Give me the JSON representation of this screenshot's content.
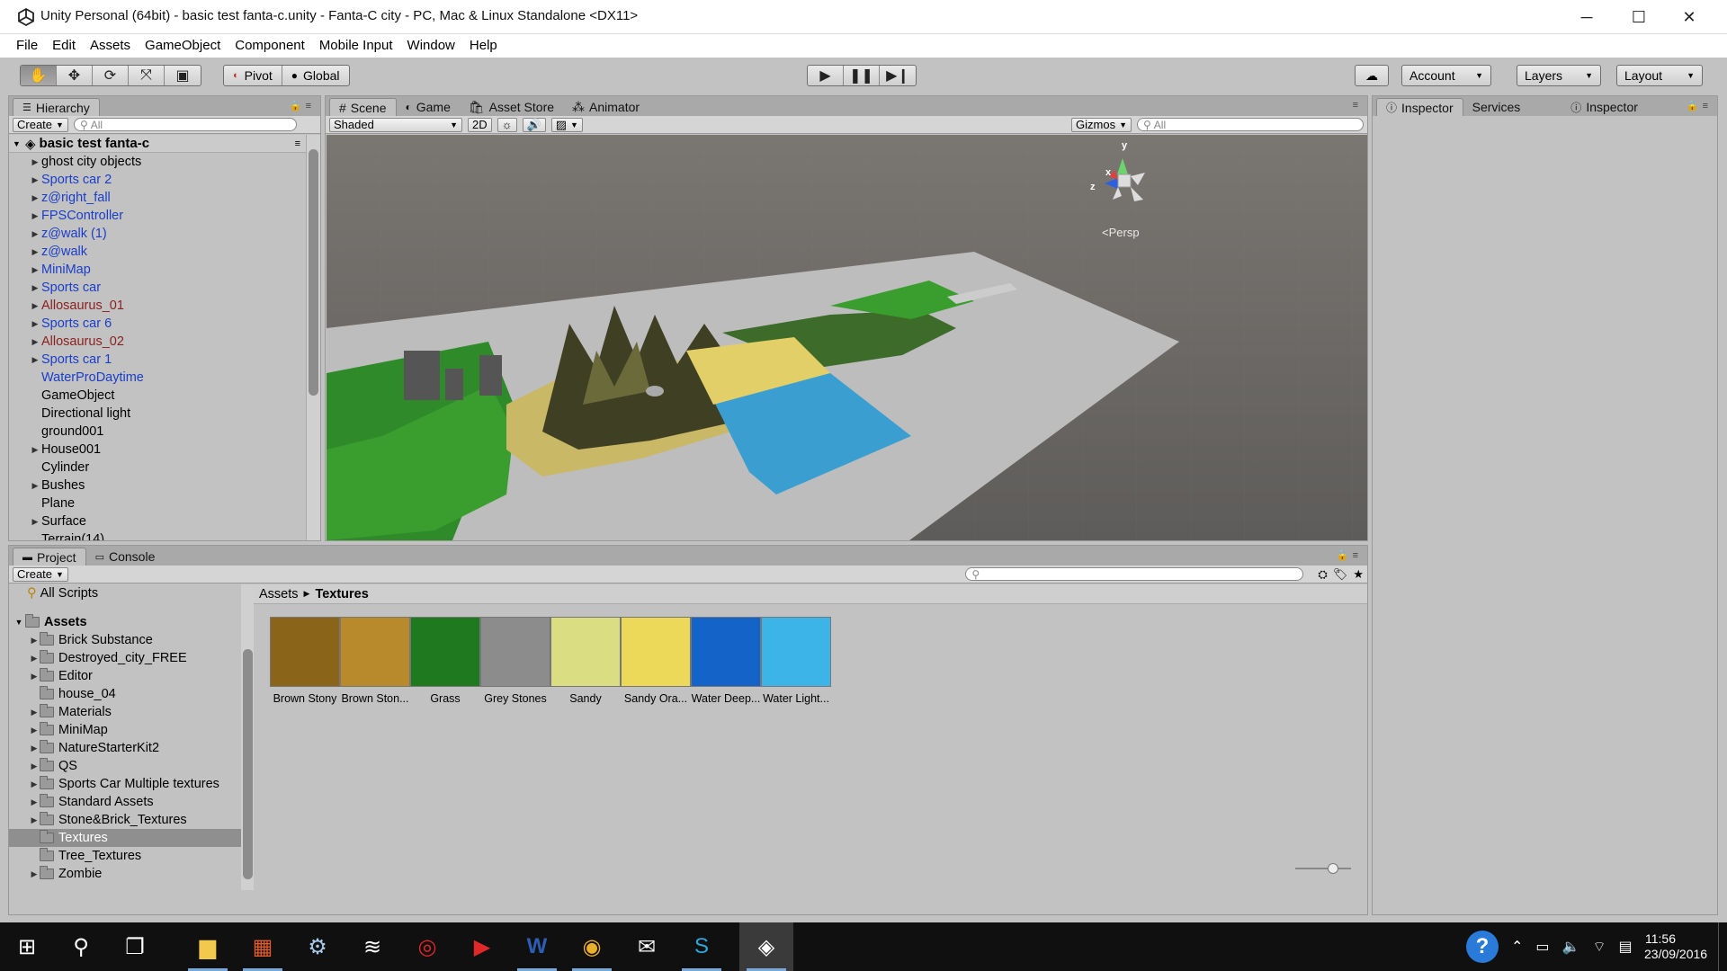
{
  "window": {
    "title": "Unity Personal (64bit) - basic test fanta-c.unity - Fanta-C city - PC, Mac & Linux Standalone <DX11>",
    "minimize": "─",
    "maximize": "☐",
    "close": "✕"
  },
  "menu": [
    "File",
    "Edit",
    "Assets",
    "GameObject",
    "Component",
    "Mobile Input",
    "Window",
    "Help"
  ],
  "toolbar": {
    "pivot": "Pivot",
    "global": "Global",
    "account": "Account",
    "layers": "Layers",
    "layout": "Layout"
  },
  "hierarchy": {
    "tab": "Hierarchy",
    "create": "Create",
    "search_placeholder": "All",
    "scene": "basic test fanta-c",
    "items": [
      {
        "label": "ghost city objects",
        "expand": true,
        "color": "black"
      },
      {
        "label": "Sports car 2",
        "expand": true,
        "color": "blue"
      },
      {
        "label": "z@right_fall",
        "expand": true,
        "color": "blue"
      },
      {
        "label": "FPSController",
        "expand": true,
        "color": "blue"
      },
      {
        "label": "z@walk (1)",
        "expand": true,
        "color": "blue"
      },
      {
        "label": "z@walk",
        "expand": true,
        "color": "blue"
      },
      {
        "label": "MiniMap",
        "expand": true,
        "color": "blue"
      },
      {
        "label": "Sports car",
        "expand": true,
        "color": "blue"
      },
      {
        "label": "Allosaurus_01",
        "expand": true,
        "color": "red"
      },
      {
        "label": "Sports car 6",
        "expand": true,
        "color": "blue"
      },
      {
        "label": "Allosaurus_02",
        "expand": true,
        "color": "red"
      },
      {
        "label": "Sports car 1",
        "expand": true,
        "color": "blue"
      },
      {
        "label": "WaterProDaytime",
        "expand": false,
        "color": "blue"
      },
      {
        "label": "GameObject",
        "expand": false,
        "color": "black"
      },
      {
        "label": "Directional light",
        "expand": false,
        "color": "black"
      },
      {
        "label": "ground001",
        "expand": false,
        "color": "black"
      },
      {
        "label": "House001",
        "expand": true,
        "color": "black"
      },
      {
        "label": "Cylinder",
        "expand": false,
        "color": "black"
      },
      {
        "label": "Bushes",
        "expand": true,
        "color": "black"
      },
      {
        "label": "Plane",
        "expand": false,
        "color": "black"
      },
      {
        "label": "Surface",
        "expand": true,
        "color": "black"
      },
      {
        "label": "Terrain(14)",
        "expand": false,
        "color": "black"
      }
    ]
  },
  "scene_tabs": {
    "scene": "Scene",
    "game": "Game",
    "asset_store": "Asset Store",
    "animator": "Animator"
  },
  "scene_bar": {
    "shaded": "Shaded",
    "two_d": "2D",
    "gizmos": "Gizmos",
    "search_placeholder": "All"
  },
  "gizmo": {
    "x": "x",
    "y": "y",
    "z": "z",
    "persp": "Persp"
  },
  "inspector_tabs": {
    "inspector": "Inspector",
    "services": "Services",
    "inspector2": "Inspector"
  },
  "project": {
    "tab": "Project",
    "console": "Console",
    "create": "Create",
    "favorites": [
      {
        "label": "All Scripts"
      }
    ],
    "root": "Assets",
    "folders": [
      {
        "label": "Brick Substance",
        "expand": true,
        "selected": false
      },
      {
        "label": "Destroyed_city_FREE",
        "expand": true,
        "selected": false
      },
      {
        "label": "Editor",
        "expand": true,
        "selected": false
      },
      {
        "label": "house_04",
        "expand": false,
        "selected": false
      },
      {
        "label": "Materials",
        "expand": true,
        "selected": false
      },
      {
        "label": "MiniMap",
        "expand": true,
        "selected": false
      },
      {
        "label": "NatureStarterKit2",
        "expand": true,
        "selected": false
      },
      {
        "label": "QS",
        "expand": true,
        "selected": false
      },
      {
        "label": "Sports Car Multiple textures",
        "expand": true,
        "selected": false
      },
      {
        "label": "Standard Assets",
        "expand": true,
        "selected": false
      },
      {
        "label": "Stone&Brick_Textures",
        "expand": true,
        "selected": false
      },
      {
        "label": "Textures",
        "expand": false,
        "selected": true
      },
      {
        "label": "Tree_Textures",
        "expand": false,
        "selected": false
      },
      {
        "label": "Zombie",
        "expand": true,
        "selected": false
      }
    ],
    "breadcrumb": [
      "Assets",
      "Textures"
    ],
    "assets": [
      {
        "label": "Brown Stony",
        "color": "#8a6418"
      },
      {
        "label": "Brown Ston...",
        "color": "#b98a2c"
      },
      {
        "label": "Grass",
        "color": "#1f7a1f"
      },
      {
        "label": "Grey Stones",
        "color": "#8c8c8c"
      },
      {
        "label": "Sandy",
        "color": "#dadd82"
      },
      {
        "label": "Sandy Ora...",
        "color": "#ecd95a"
      },
      {
        "label": "Water Deep...",
        "color": "#1463c8"
      },
      {
        "label": "Water Light...",
        "color": "#3cb4e8"
      }
    ]
  },
  "taskbar": {
    "time": "11:56",
    "date": "23/09/2016"
  },
  "colors": {
    "editor_bg": "#c2c2c2",
    "prefab_blue": "#1a3ec8",
    "missing_red": "#8a1f1f",
    "taskbar": "#101010"
  }
}
